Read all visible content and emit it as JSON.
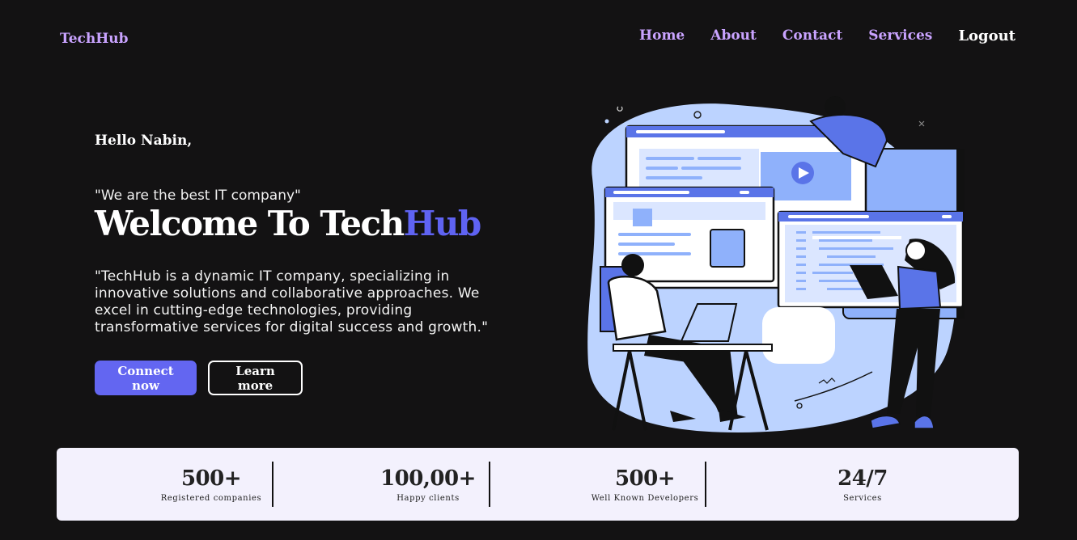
{
  "brand": "TechHub",
  "nav": {
    "items": [
      "Home",
      "About",
      "Contact",
      "Services"
    ],
    "logout": "Logout"
  },
  "hero": {
    "greeting": "Hello Nabin,",
    "quote": "\"We are the best IT company\"",
    "title_main": "Welcome To Tech",
    "title_accent": "Hub",
    "description": "\"TechHub is a dynamic IT company, specializing in innovative solutions and collaborative approaches. We excel in cutting-edge technologies, providing transformative services for digital success and growth.\"",
    "primary_button": "Connect now",
    "secondary_button": "Learn more",
    "illustration_icon": "developers-illustration"
  },
  "stats": [
    {
      "value": "500+",
      "label": "Registered companies"
    },
    {
      "value": "100,00+",
      "label": "Happy clients"
    },
    {
      "value": "500+",
      "label": "Well Known Developers"
    },
    {
      "value": "24/7",
      "label": "Services"
    }
  ],
  "colors": {
    "background": "#131213",
    "accent": "#6366f1",
    "nav_link": "#c9a3ff",
    "stats_bg": "#f3f1fd"
  }
}
